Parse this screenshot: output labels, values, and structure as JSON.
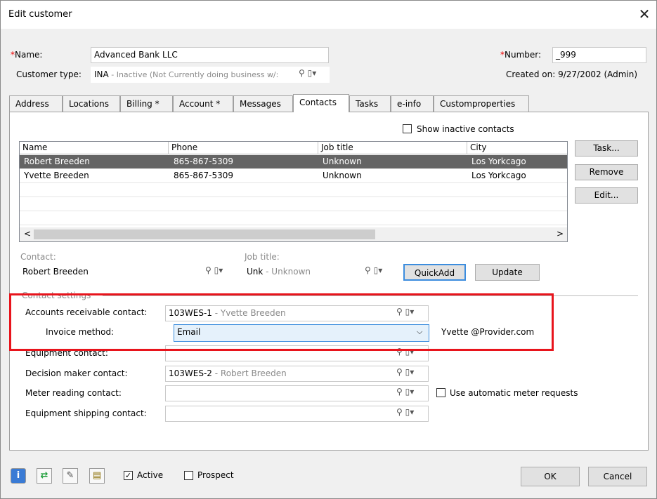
{
  "window": {
    "title": "Edit customer",
    "close": "✕"
  },
  "header": {
    "name_label": "Name:",
    "name_value": "Advanced Bank LLC",
    "number_label": "Number:",
    "number_value": "_999",
    "customer_type_label": "Customer type:",
    "customer_type_code": "INA",
    "customer_type_desc": " - Inactive (Not Currently doing business w/:",
    "created_on": "Created on: 9/27/2002 (Admin)"
  },
  "tabs": [
    {
      "label": "Address"
    },
    {
      "label": "Locations"
    },
    {
      "label": "Billing *"
    },
    {
      "label": "Account *"
    },
    {
      "label": "Messages"
    },
    {
      "label": "Contacts"
    },
    {
      "label": "Tasks"
    },
    {
      "label": "e-info"
    },
    {
      "label": "Customproperties"
    }
  ],
  "contacts": {
    "show_inactive_label": "Show inactive contacts",
    "columns": [
      "Name",
      "Phone",
      "Job title",
      "City"
    ],
    "rows": [
      {
        "name": "Robert Breeden",
        "phone": "865-867-5309",
        "job": "Unknown",
        "city": "Los Yorkcago"
      },
      {
        "name": "Yvette Breeden",
        "phone": "865-867-5309",
        "job": "Unknown",
        "city": "Los Yorkcago"
      }
    ],
    "task_btn": "Task...",
    "remove_btn": "Remove",
    "edit_btn": "Edit...",
    "contact_label": "Contact:",
    "contact_value": "Robert Breeden",
    "job_title_label": "Job title:",
    "job_code": "Unk",
    "job_desc": " - Unknown",
    "quickadd_btn": "QuickAdd",
    "update_btn": "Update"
  },
  "settings": {
    "section_label": "Contact settings",
    "ar_label": "Accounts receivable contact:",
    "ar_code": "103WES-1",
    "ar_desc": " - Yvette Breeden",
    "invoice_label": "Invoice method:",
    "invoice_value": "Email",
    "invoice_email": "Yvette @Provider.com",
    "equipment_label": "Equipment contact:",
    "decision_label": "Decision maker contact:",
    "decision_code": "103WES-2",
    "decision_desc": " - Robert Breeden",
    "meter_label": "Meter reading contact:",
    "auto_meter_label": "Use automatic meter requests",
    "shipping_label": "Equipment shipping contact:"
  },
  "footer": {
    "active_label": "Active",
    "prospect_label": "Prospect",
    "ok_btn": "OK",
    "cancel_btn": "Cancel"
  },
  "colors": {
    "highlight_box": "#e8141c",
    "selected_row": "#646464",
    "focus_border": "#3c8dde"
  }
}
